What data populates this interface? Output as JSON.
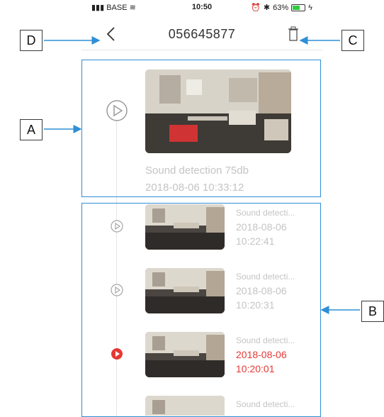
{
  "status_bar": {
    "carrier": "BASE",
    "time": "10:50",
    "battery": "63%"
  },
  "header": {
    "title": "056645877"
  },
  "featured": {
    "description": "Sound detection 75db",
    "datetime": "2018-08-06  10:33:12"
  },
  "events": [
    {
      "description": "Sound detecti...",
      "date": "2018-08-06",
      "time": "10:22:41",
      "active": false
    },
    {
      "description": "Sound detecti...",
      "date": "2018-08-06",
      "time": "10:20:31",
      "active": false
    },
    {
      "description": "Sound detecti...",
      "date": "2018-08-06",
      "time": "10:20:01",
      "active": true
    },
    {
      "description": "Sound detecti...",
      "date": "",
      "time": "",
      "active": false
    }
  ],
  "annotations": {
    "a": "A",
    "b": "B",
    "c": "C",
    "d": "D"
  },
  "colors": {
    "accent_red": "#e53935",
    "annotation_blue": "#2f8fd6",
    "muted_text": "#c4c4c4"
  }
}
